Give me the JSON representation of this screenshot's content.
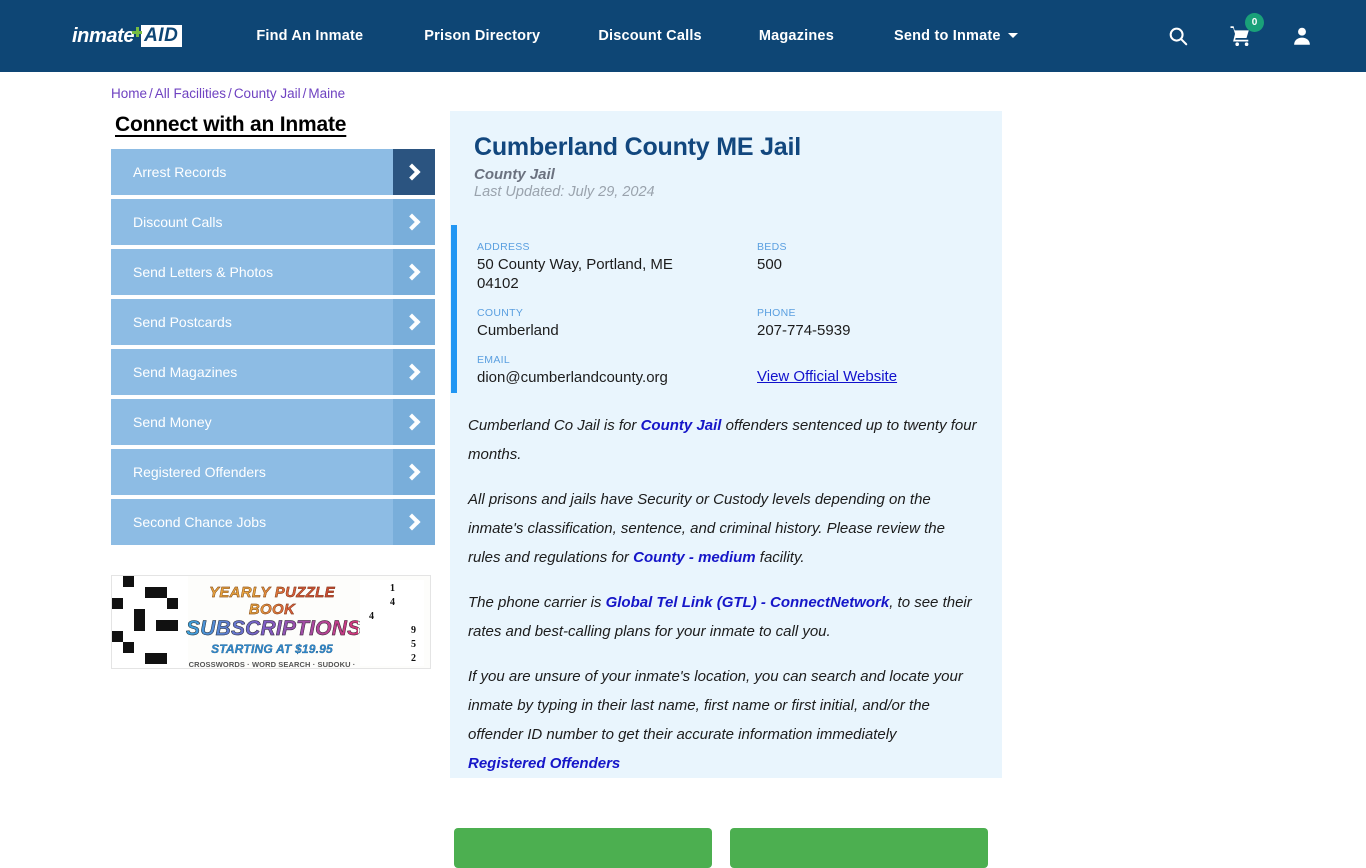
{
  "header": {
    "logo": {
      "word": "inmate",
      "cross": "green-cross-icon",
      "box": "AID"
    },
    "nav": [
      {
        "label": "Find An Inmate",
        "name": "nav-find-an-inmate"
      },
      {
        "label": "Prison Directory",
        "name": "nav-prison-directory"
      },
      {
        "label": "Discount Calls",
        "name": "nav-discount-calls"
      },
      {
        "label": "Magazines",
        "name": "nav-magazines"
      },
      {
        "label": "Send to Inmate",
        "name": "nav-send-to-inmate",
        "has_caret": true
      }
    ],
    "icons": {
      "search": "search-icon",
      "cart": "cart-icon",
      "cart_count": "0",
      "account": "user-account-icon"
    },
    "colors": {
      "background": "#0e4675",
      "badge": "#1aa179"
    }
  },
  "breadcrumb": {
    "items": [
      "Home",
      "All Facilities",
      "County Jail",
      "Maine"
    ],
    "separator": "/"
  },
  "sidebar": {
    "title": "Connect with an Inmate",
    "items": [
      {
        "label": "Arrest Records",
        "active": true
      },
      {
        "label": "Discount Calls",
        "active": false
      },
      {
        "label": "Send Letters & Photos",
        "active": false
      },
      {
        "label": "Send Postcards",
        "active": false
      },
      {
        "label": "Send Magazines",
        "active": false
      },
      {
        "label": "Send Money",
        "active": false
      },
      {
        "label": "Registered Offenders",
        "active": false
      },
      {
        "label": "Second Chance Jobs",
        "active": false
      }
    ]
  },
  "ad": {
    "line1": "YEARLY PUZZLE BOOK",
    "line2": "SUBSCRIPTIONS",
    "line3": "STARTING AT $19.95",
    "line4": "CROSSWORDS · WORD SEARCH · SUDOKU · BRAIN TEASERS",
    "sudoku_digits": [
      "1",
      "4",
      "4",
      "9",
      "5",
      "2"
    ]
  },
  "facility": {
    "name": "Cumberland County ME Jail",
    "type": "County Jail",
    "last_updated": "Last Updated: July 29, 2024",
    "info": {
      "address_label": "ADDRESS",
      "address_value": "50 County Way, Portland, ME 04102",
      "beds_label": "BEDS",
      "beds_value": "500",
      "county_label": "COUNTY",
      "county_value": "Cumberland",
      "phone_label": "PHONE",
      "phone_value": "207-774-5939",
      "email_label": "EMAIL",
      "email_value": "dion@cumberlandcounty.org",
      "website_link": "View Official Website"
    },
    "paragraphs": {
      "p1_a": "Cumberland Co Jail is for ",
      "p1_link": "County Jail",
      "p1_b": " offenders sentenced up to twenty four months.",
      "p2_a": "All prisons and jails have Security or Custody levels depending on the inmate's classification, sentence, and criminal history. Please review the rules and regulations for ",
      "p2_link": "County - medium",
      "p2_b": " facility.",
      "p3_a": "The phone carrier is ",
      "p3_link": "Global Tel Link (GTL) - ConnectNetwork",
      "p3_b": ", to see their rates and best-calling plans for your inmate to call you.",
      "p4_a": "If you are unsure of your inmate's location, you can search and locate your inmate by typing in their last name, first name or first initial, and/or the offender ID number to get their accurate information immediately ",
      "p4_link": "Registered Offenders"
    },
    "actions": [
      {
        "label": ""
      },
      {
        "label": ""
      }
    ]
  }
}
